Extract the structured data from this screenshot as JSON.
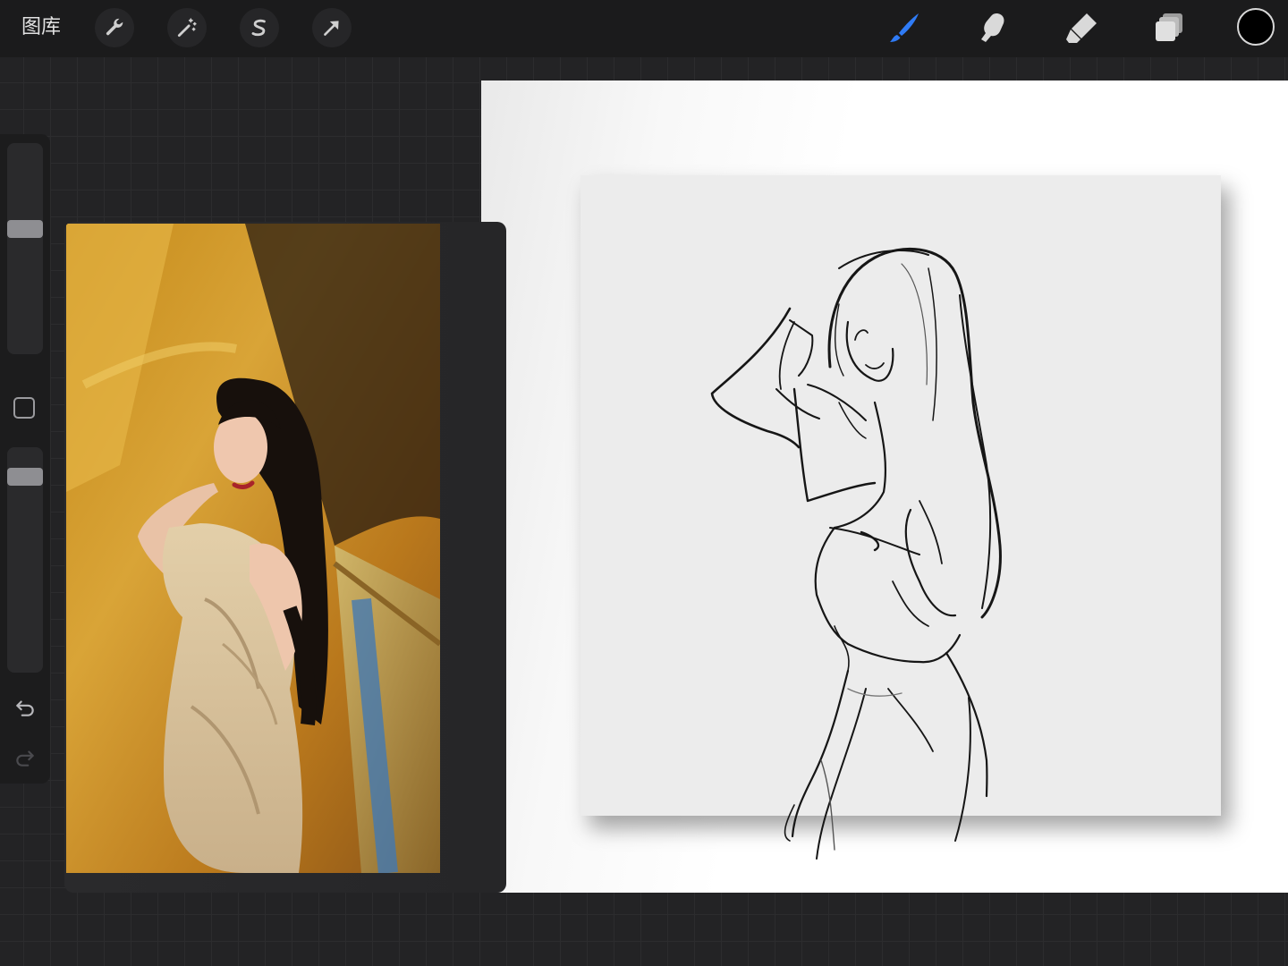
{
  "app": {
    "gallery_label": "图库"
  },
  "toolbar": {
    "left_tools": [
      {
        "name": "actions",
        "icon": "wrench-icon"
      },
      {
        "name": "adjustments",
        "icon": "magic-wand-icon"
      },
      {
        "name": "selection",
        "icon": "selection-s-icon"
      },
      {
        "name": "transform",
        "icon": "arrow-cursor-icon"
      }
    ],
    "right_tools": [
      {
        "name": "brush",
        "icon": "brush-icon",
        "active": true
      },
      {
        "name": "smudge",
        "icon": "smudge-finger-icon",
        "active": false
      },
      {
        "name": "eraser",
        "icon": "eraser-icon",
        "active": false
      },
      {
        "name": "layers",
        "icon": "layers-icon",
        "active": false
      }
    ],
    "current_color": "#000000",
    "active_color": "#2f7bf5"
  },
  "sidebar": {
    "brush_size_level": 0.6,
    "opacity_level": 0.9
  }
}
